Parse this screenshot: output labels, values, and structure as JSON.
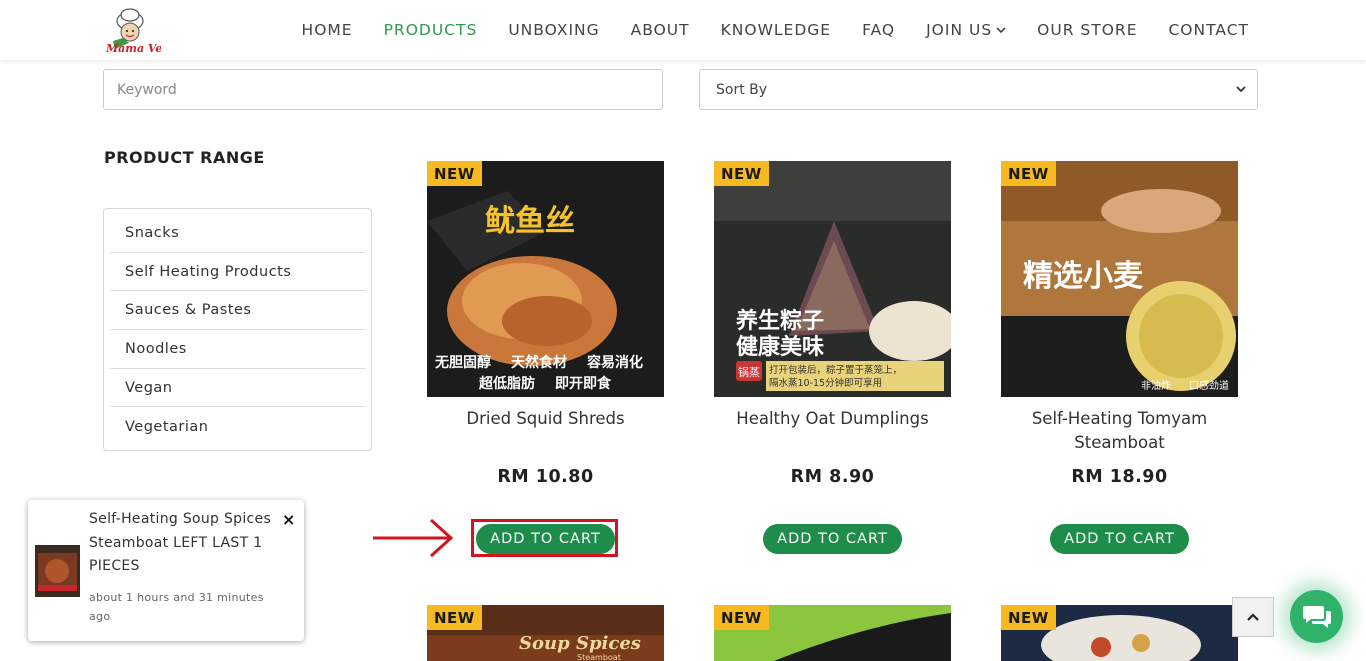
{
  "header": {
    "logo_text": "Mama Vege",
    "nav": [
      {
        "label": "HOME"
      },
      {
        "label": "PRODUCTS"
      },
      {
        "label": "UNBOXING"
      },
      {
        "label": "ABOUT"
      },
      {
        "label": "KNOWLEDGE"
      },
      {
        "label": "FAQ"
      },
      {
        "label": "JOIN US"
      },
      {
        "label": "OUR STORE"
      },
      {
        "label": "CONTACT"
      }
    ],
    "active": "PRODUCTS"
  },
  "search": {
    "placeholder": "Keyword",
    "value": ""
  },
  "sort": {
    "selected": "Sort By"
  },
  "sidebar": {
    "title": "PRODUCT RANGE",
    "items": [
      {
        "label": "Snacks"
      },
      {
        "label": "Self Heating Products"
      },
      {
        "label": "Sauces & Pastes"
      },
      {
        "label": "Noodles"
      },
      {
        "label": "Vegan"
      },
      {
        "label": "Vegetarian"
      }
    ]
  },
  "products": [
    {
      "badge": "NEW",
      "name": "Dried Squid Shreds",
      "price": "RM 10.80",
      "button": "ADD TO CART",
      "image_text": [
        "鱿鱼丝",
        "无胆固醇",
        "天然食材",
        "容易消化",
        "超低脂肪",
        "即开即食"
      ]
    },
    {
      "badge": "NEW",
      "name": "Healthy Oat Dumplings",
      "price": "RM 8.90",
      "button": "ADD TO CART",
      "image_text": [
        "养生粽子",
        "健康美味",
        "锅蒸",
        "打开包装后，粽子置于蒸笼上，",
        "隔水蒸10-15分钟即可享用"
      ]
    },
    {
      "badge": "NEW",
      "name": "Self-Heating Tomyam Steamboat",
      "price": "RM 18.90",
      "button": "ADD TO CART",
      "image_text": [
        "精选小麦",
        "非油炸",
        "口感劲道"
      ]
    },
    {
      "badge": "NEW",
      "image_text": [
        "Soup Spices",
        "Steamboat"
      ]
    },
    {
      "badge": "NEW",
      "image_text": []
    },
    {
      "badge": "NEW",
      "image_text": []
    }
  ],
  "notification": {
    "title": "Self-Heating Soup Spices Steamboat LEFT LAST 1 PIECES",
    "time": "about 1 hours and 31 minutes ago",
    "close": "×"
  },
  "colors": {
    "brand_green": "#2d9a4b",
    "button_green": "#1e8c4a",
    "badge_yellow": "#f6b920",
    "highlight_red": "#d3161e"
  },
  "icons": {
    "scroll_top": "chevron-up-icon",
    "chat": "chat-icon",
    "nav_dropdown": "chevron-down-icon"
  }
}
